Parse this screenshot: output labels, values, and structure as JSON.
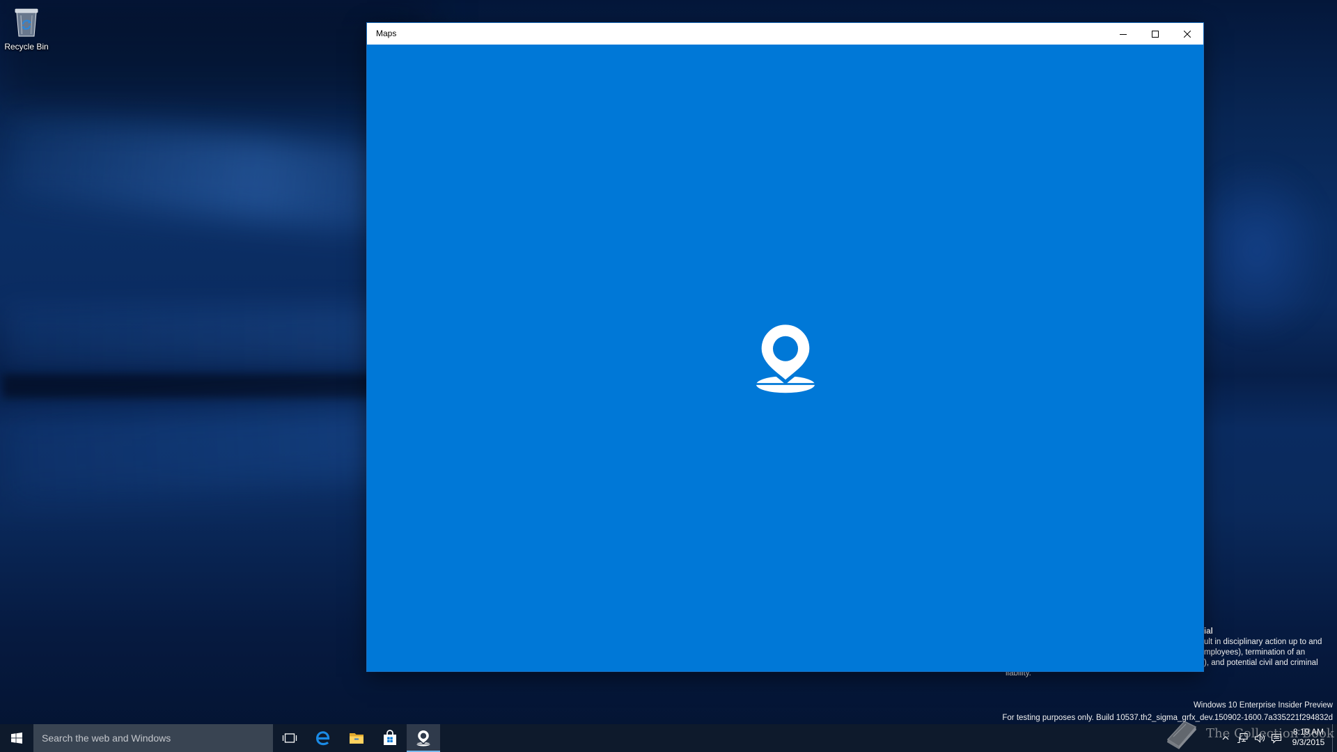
{
  "desktop": {
    "icons": [
      {
        "label": "Recycle Bin",
        "icon": "recycle-bin-icon"
      }
    ],
    "watermark": {
      "partial_lines": [
        "ial",
        "ult in disciplinary action up to and",
        "mployees), termination of an",
        "), and potential civil and criminal"
      ],
      "last_line": "liability.",
      "edition": "Windows 10 Enterprise Insider Preview",
      "build": "For testing purposes only. Build 10537.th2_sigma_grfx_dev.150902-1600.7a335221f294832d"
    },
    "site_watermark": {
      "text": "The Collection Book",
      "icon": "book-icon"
    }
  },
  "window": {
    "title": "Maps",
    "controls": [
      {
        "icon": "minimize-icon"
      },
      {
        "icon": "maximize-icon"
      },
      {
        "icon": "close-icon"
      }
    ],
    "splash": {
      "icon": "maps-logo-icon"
    }
  },
  "taskbar": {
    "start_icon": "windows-logo-icon",
    "search_placeholder": "Search the web and Windows",
    "apps": [
      {
        "icon": "task-view-icon",
        "active": false
      },
      {
        "icon": "edge-icon",
        "active": false
      },
      {
        "icon": "file-explorer-icon",
        "active": false
      },
      {
        "icon": "store-icon",
        "active": false
      },
      {
        "icon": "maps-icon",
        "active": true
      }
    ],
    "tray": {
      "icons": [
        "chevron-up-icon",
        "network-icon",
        "volume-icon",
        "action-center-icon"
      ],
      "time": "8:19 AM",
      "date": "9/3/2015"
    }
  },
  "colors": {
    "accent": "#0078D7",
    "taskbar": "#0e1a2c",
    "search_box": "#394452",
    "title_bar": "#ffffff",
    "active_indicator": "#76b9ed"
  }
}
